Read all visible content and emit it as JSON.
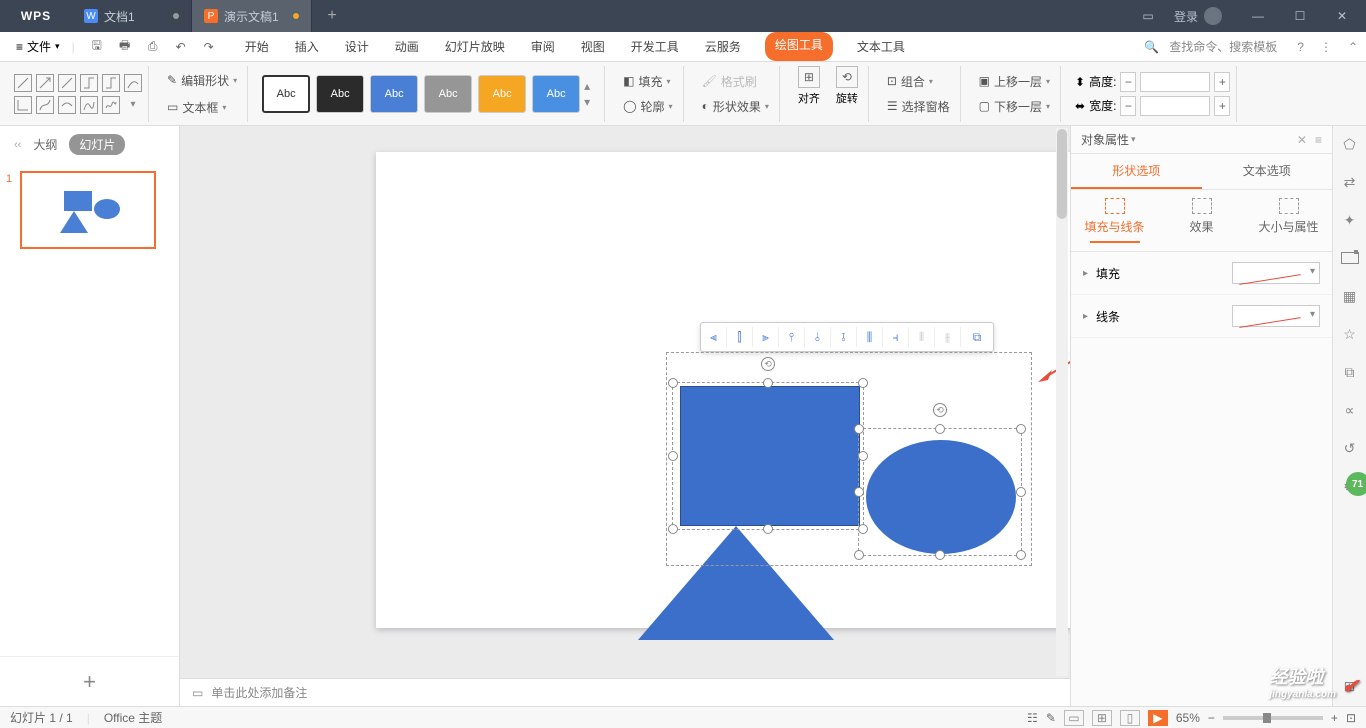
{
  "app": {
    "name": "WPS"
  },
  "tabs": [
    {
      "label": "文档1",
      "kind": "doc"
    },
    {
      "label": "演示文稿1",
      "kind": "ppt",
      "modified": true
    }
  ],
  "login": {
    "label": "登录"
  },
  "file_menu": {
    "label": "文件"
  },
  "menus": [
    "开始",
    "插入",
    "设计",
    "动画",
    "幻灯片放映",
    "审阅",
    "视图",
    "开发工具",
    "云服务",
    "绘图工具",
    "文本工具"
  ],
  "active_menu": "绘图工具",
  "search": {
    "placeholder": "查找命令、搜索模板"
  },
  "ribbon": {
    "edit_shape": "编辑形状",
    "textbox": "文本框",
    "styles": [
      "Abc",
      "Abc",
      "Abc",
      "Abc",
      "Abc",
      "Abc"
    ],
    "fill": "填充",
    "outline": "轮廓",
    "format_painter": "格式刷",
    "shape_effect": "形状效果",
    "align": "对齐",
    "rotate": "旋转",
    "group": "组合",
    "select_pane": "选择窗格",
    "bring_fwd": "上移一层",
    "send_back": "下移一层",
    "height": "高度:",
    "width": "宽度:"
  },
  "left": {
    "outline": "大纲",
    "slides": "幻灯片",
    "thumb_num": "1"
  },
  "notes": {
    "placeholder": "单击此处添加备注"
  },
  "right_panel": {
    "title": "对象属性",
    "tab_shape": "形状选项",
    "tab_text": "文本选项",
    "sub_fill": "填充与线条",
    "sub_effect": "效果",
    "sub_size": "大小与属性",
    "sec_fill": "填充",
    "sec_line": "线条"
  },
  "status": {
    "slide": "幻灯片 1 / 1",
    "theme": "Office 主题",
    "zoom": "65%"
  },
  "watermark": {
    "brand": "经验啦",
    "url": "jingyanla.com"
  }
}
